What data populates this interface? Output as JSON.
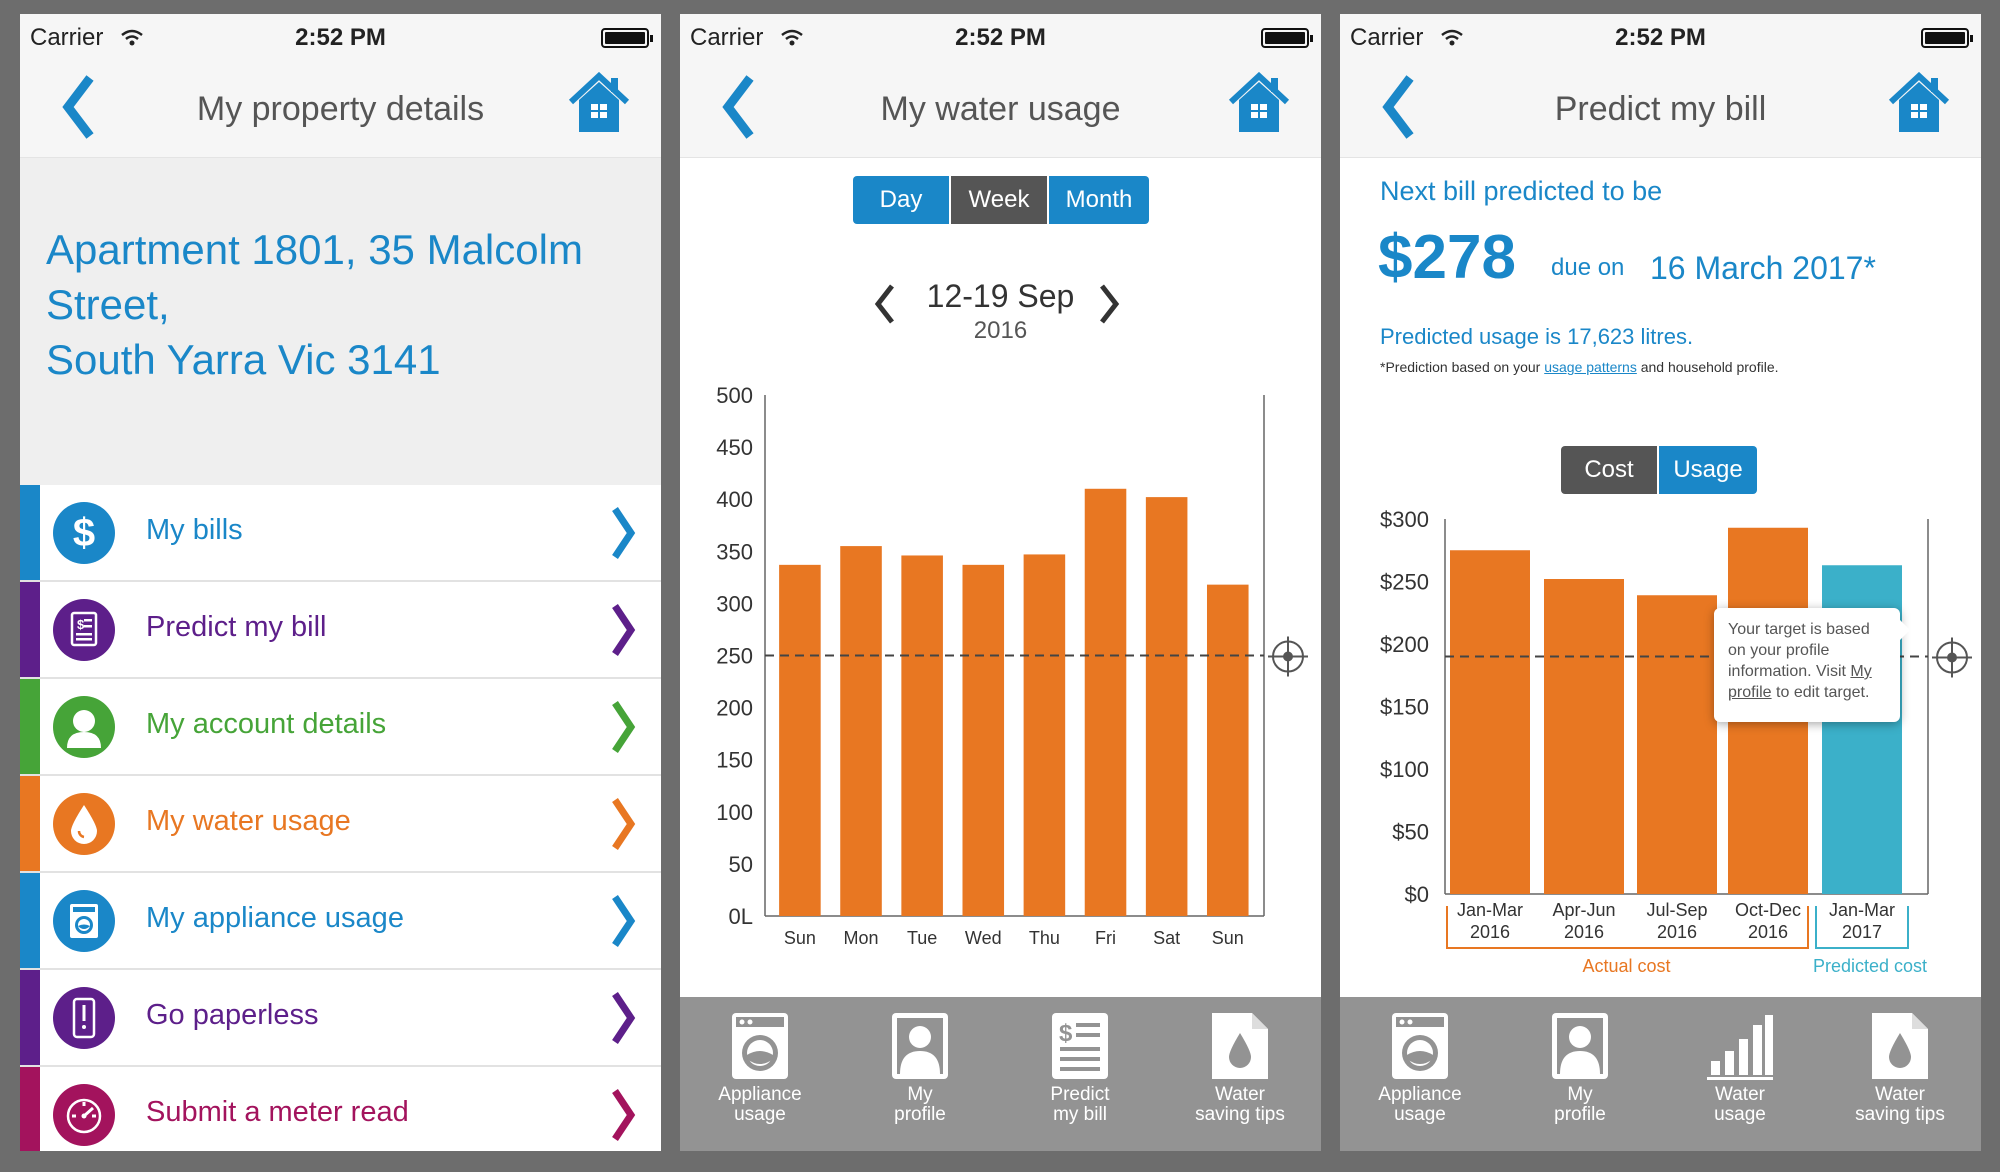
{
  "status_bar": {
    "carrier": "Carrier",
    "time": "2:52 PM"
  },
  "colors": {
    "brand_blue": "#1a87c8",
    "purple": "#5d1f8a",
    "green": "#46a438",
    "orange": "#e87722",
    "magenta": "#a3135d",
    "teal": "#3bb0c9",
    "dark_gray": "#555555",
    "tab_gray": "#939393"
  },
  "screen1": {
    "title": "My property details",
    "address": [
      "Apartment 1801, 35 Malcolm",
      "Street,",
      "South Yarra Vic 3141"
    ],
    "menu": [
      {
        "label": "My bills",
        "icon": "dollar-icon",
        "color": "#1a87c8"
      },
      {
        "label": "Predict my bill",
        "icon": "bill-icon",
        "color": "#5d1f8a"
      },
      {
        "label": "My account details",
        "icon": "person-icon",
        "color": "#46a438"
      },
      {
        "label": "My water usage",
        "icon": "water-drop-icon",
        "color": "#e87722"
      },
      {
        "label": "My appliance usage",
        "icon": "washing-machine-icon",
        "color": "#1a87c8"
      },
      {
        "label": "Go paperless",
        "icon": "phone-icon",
        "color": "#5d1f8a"
      },
      {
        "label": "Submit a meter read",
        "icon": "meter-icon",
        "color": "#a3135d"
      }
    ]
  },
  "screen2": {
    "title": "My water usage",
    "segments": [
      "Day",
      "Week",
      "Month"
    ],
    "selected_segment": "Week",
    "date_range": "12-19 Sep",
    "year": "2016",
    "tabs": [
      {
        "label": [
          "Appliance",
          "usage"
        ],
        "icon": "washing-machine-icon"
      },
      {
        "label": [
          "My",
          "profile"
        ],
        "icon": "profile-icon"
      },
      {
        "label": [
          "Predict",
          "my bill"
        ],
        "icon": "bill-icon"
      },
      {
        "label": [
          "Water",
          "saving tips"
        ],
        "icon": "water-tip-icon"
      }
    ]
  },
  "screen3": {
    "title": "Predict my bill",
    "heading": "Next bill predicted to be",
    "amount": "$278",
    "due_label": "due on",
    "due_date": "16 March 2017*",
    "usage_text": "Predicted usage is 17,623 litres.",
    "note_prefix": "*Prediction based on your ",
    "note_link": "usage patterns",
    "note_suffix": " and household profile.",
    "segments": [
      "Cost",
      "Usage"
    ],
    "selected_segment": "Usage",
    "tooltip": {
      "text1": "Your target is based on your profile information. Visit ",
      "link": "My profile",
      "text2": " to edit target."
    },
    "tabs": [
      {
        "label": [
          "Appliance",
          "usage"
        ],
        "icon": "washing-machine-icon"
      },
      {
        "label": [
          "My",
          "profile"
        ],
        "icon": "profile-icon"
      },
      {
        "label": [
          "Water",
          "usage"
        ],
        "icon": "bar-chart-icon"
      },
      {
        "label": [
          "Water",
          "saving tips"
        ],
        "icon": "water-tip-icon"
      }
    ]
  },
  "chart_data": [
    {
      "type": "bar",
      "categories": [
        "Sun",
        "Mon",
        "Tue",
        "Wed",
        "Thu",
        "Fri",
        "Sat",
        "Sun"
      ],
      "values": [
        337,
        355,
        346,
        337,
        347,
        410,
        402,
        318
      ],
      "y_ticks": [
        "0L",
        "50",
        "100",
        "150",
        "200",
        "250",
        "300",
        "350",
        "400",
        "450",
        "500"
      ],
      "ylim": [
        0,
        500
      ],
      "target": 250,
      "color": "#e87722",
      "grid": false
    },
    {
      "type": "bar",
      "categories": [
        [
          "Jan-Mar",
          "2016"
        ],
        [
          "Apr-Jun",
          "2016"
        ],
        [
          "Jul-Sep",
          "2016"
        ],
        [
          "Oct-Dec",
          "2016"
        ],
        [
          "Jan-Mar",
          "2017"
        ]
      ],
      "values": [
        275,
        252,
        239,
        293,
        263
      ],
      "kinds": [
        "actual",
        "actual",
        "actual",
        "actual",
        "predicted"
      ],
      "y_ticks": [
        "$0",
        "$50",
        "$100",
        "$150",
        "$200",
        "$250",
        "$300"
      ],
      "ylim": [
        0,
        300
      ],
      "target": 190,
      "group_labels": {
        "actual": "Actual cost",
        "predicted": "Predicted cost"
      },
      "colors": {
        "actual": "#e87722",
        "predicted": "#3bb0c9"
      },
      "grid": false
    }
  ]
}
